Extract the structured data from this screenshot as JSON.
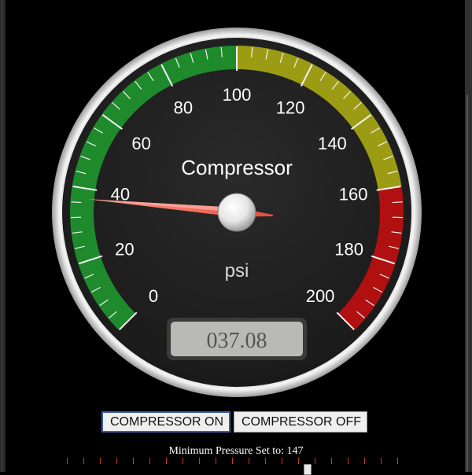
{
  "gauge": {
    "title": "Compressor",
    "unit": "psi",
    "min": 0,
    "max": 200,
    "value": 37.08,
    "readout": "037.08",
    "tick_labels": [
      "0",
      "20",
      "40",
      "60",
      "80",
      "100",
      "120",
      "140",
      "160",
      "180",
      "200"
    ],
    "bands": [
      {
        "from": 0,
        "to": 100,
        "color": "#1e8a2c"
      },
      {
        "from": 100,
        "to": 160,
        "color": "#9c9c14"
      },
      {
        "from": 160,
        "to": 200,
        "color": "#b01010"
      }
    ],
    "colors": {
      "face": "#222222",
      "rim": "#e0e0e0",
      "needle": "#ff8070",
      "text": "#ffffff",
      "readout_bg": "#b9b9b5"
    }
  },
  "controls": {
    "on_label": "COMPRESSOR ON",
    "off_label": "COMPRESSOR OFF",
    "active": "on"
  },
  "pressure": {
    "label": "Minimum Pressure Set to: 147",
    "min_setting": 147
  }
}
